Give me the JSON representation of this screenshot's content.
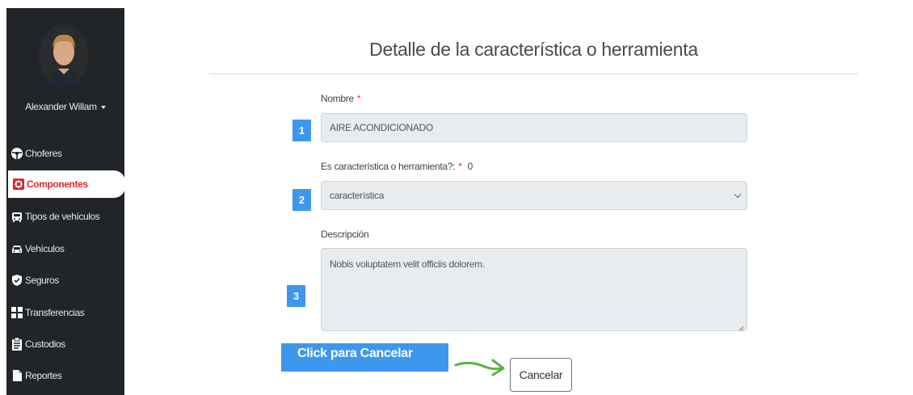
{
  "sidebar": {
    "user_name": "Alexander Willam",
    "items": [
      {
        "label": "Choferes",
        "icon": "steering-wheel-icon"
      },
      {
        "label": "Componentes",
        "icon": "component-icon"
      },
      {
        "label": "Tipos de vehículos",
        "icon": "bus-icon"
      },
      {
        "label": "Vehículos",
        "icon": "car-icon"
      },
      {
        "label": "Seguros",
        "icon": "shield-check-icon"
      },
      {
        "label": "Transferencias",
        "icon": "transfer-icon"
      },
      {
        "label": "Custodios",
        "icon": "clipboard-icon"
      },
      {
        "label": "Reportes",
        "icon": "file-icon"
      }
    ],
    "active_item": "Componentes"
  },
  "main": {
    "title": "Detalle de la característica o herramienta",
    "form": {
      "nombre_label": "Nombre",
      "nombre_value": "AIRE ACONDICIONADO",
      "tipo_label": "Es característica o herramienta?:",
      "tipo_suffix": "0",
      "tipo_value": "característica",
      "descripcion_label": "Descripción",
      "descripcion_value": "Nobis voluptatem velit officiis dolorem.",
      "required_mark": "*"
    },
    "steps": [
      "1",
      "2",
      "3"
    ],
    "callout": "Click para Cancelar",
    "cancel_label": "Cancelar"
  },
  "colors": {
    "sidebar_bg": "#212529",
    "active_text": "#d62a2a",
    "step_badge": "#3d97ee",
    "arrow": "#5cb33a",
    "required": "#e03a3a"
  }
}
